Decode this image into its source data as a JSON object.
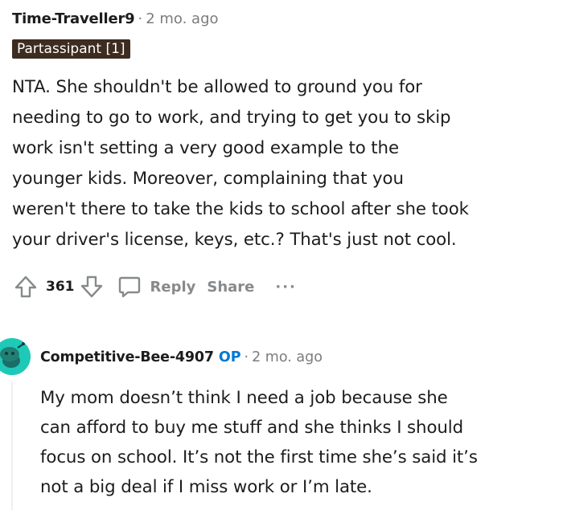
{
  "comment1": {
    "author": "Time-Traveller9",
    "separator": "·",
    "time": "2 mo. ago",
    "flair": "Partassipant [1]",
    "body_lines": [
      "NTA. She shouldn't be allowed to ground you for",
      "needing to go to work, and trying to get you to skip",
      "work isn't setting a very good example to the",
      "younger kids. Moreover, complaining that you",
      "weren't there to take the kids to school after she took",
      "your driver's license, keys, etc.? That's just not cool."
    ],
    "score": "361",
    "reply_label": "Reply",
    "share_label": "Share",
    "more_label": "···"
  },
  "comment2": {
    "author": "Competitive-Bee-4907",
    "op_badge": "OP",
    "separator": "·",
    "time": "2 mo. ago",
    "body_lines": [
      "My mom doesn’t think I need a job because she",
      "can afford to buy me stuff and she thinks I should",
      "focus on school. It’s not the first time she’s said it’s",
      "not a big deal if I miss work or I’m late."
    ]
  },
  "colors": {
    "flair_bg": "#3d2c20",
    "op_blue": "#0079d3",
    "muted": "#878a8c",
    "avatar": "#1fc9b8"
  },
  "icons": [
    "upvote-icon",
    "downvote-icon",
    "comment-bubble-icon",
    "snoo-avatar-icon"
  ]
}
